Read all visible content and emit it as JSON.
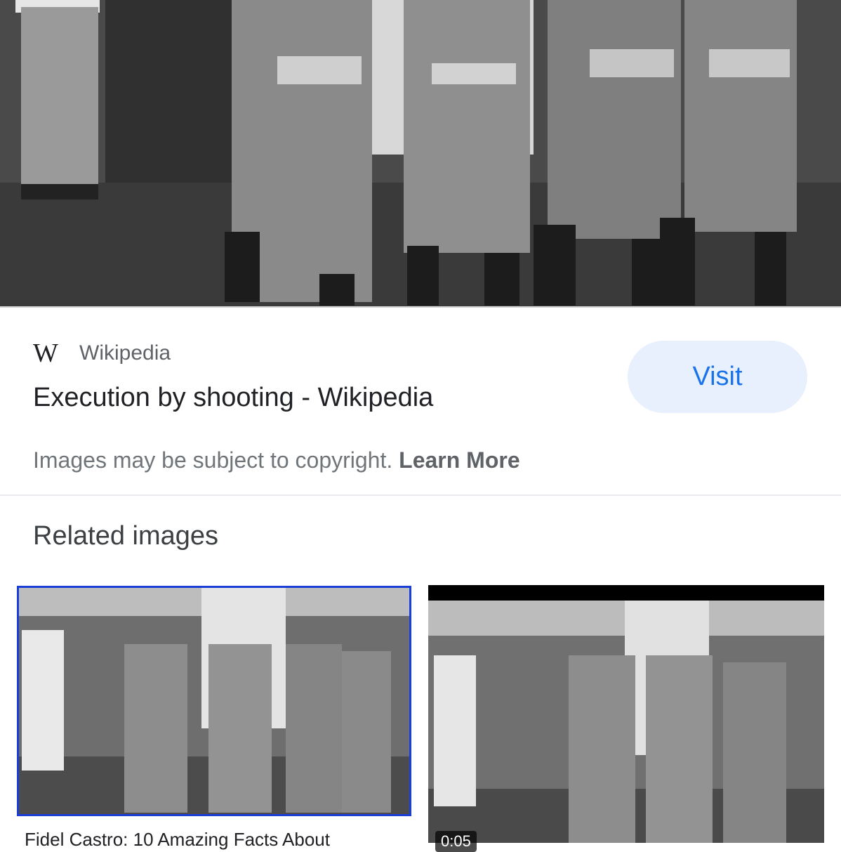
{
  "result": {
    "source_name": "Wikipedia",
    "source_logo": "W",
    "title": "Execution by shooting - Wikipedia",
    "visit_label": "Visit"
  },
  "copyright": {
    "text": "Images may be subject to copyright.",
    "learn_more": "Learn More"
  },
  "related": {
    "heading": "Related images",
    "items": [
      {
        "caption": "Fidel Castro: 10 Amazing Facts About"
      },
      {
        "duration": "0:05"
      }
    ]
  },
  "colors": {
    "accent": "#1a73e8",
    "visit_bg": "#e8f0fe",
    "selected_border": "#1a3fd6"
  }
}
